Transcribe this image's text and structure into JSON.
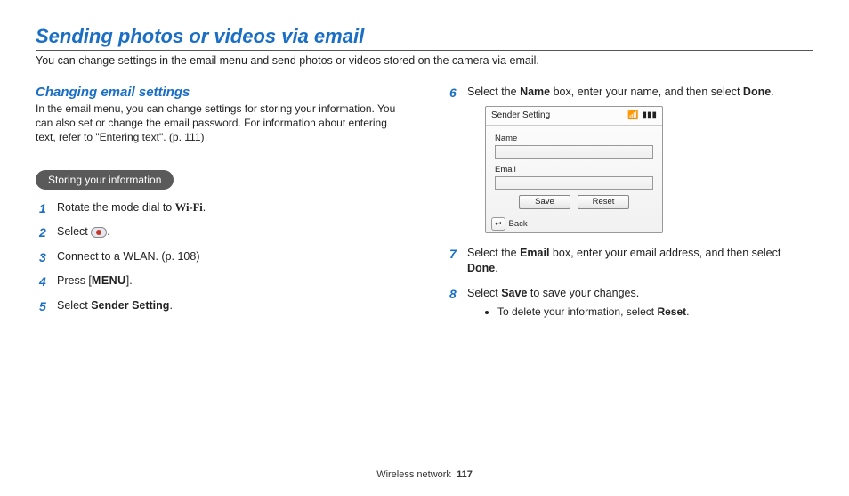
{
  "title": "Sending photos or videos via email",
  "intro": "You can change settings in the email menu and send photos or videos stored on the camera via email.",
  "left": {
    "heading": "Changing email settings",
    "para": "In the email menu, you can change settings for storing your information. You can also set or change the email password. For information about entering text, refer to \"Entering text\". (p. 111)",
    "pill": "Storing your information",
    "steps": {
      "s1_a": "Rotate the mode dial to ",
      "s1_wifi": "Wi-Fi",
      "s1_b": ".",
      "s2_a": "Select ",
      "s2_b": ".",
      "s3": "Connect to a WLAN. (p. 108)",
      "s4_a": "Press [",
      "s4_menu": "MENU",
      "s4_b": "].",
      "s5_a": "Select ",
      "s5_bold": "Sender Setting",
      "s5_b": "."
    }
  },
  "right": {
    "s6_a": "Select the ",
    "s6_bold1": "Name",
    "s6_b": " box, enter your name, and then select ",
    "s6_bold2": "Done",
    "s6_c": ".",
    "device": {
      "title": "Sender Setting",
      "name_label": "Name",
      "email_label": "Email",
      "save": "Save",
      "reset": "Reset",
      "back": "Back"
    },
    "s7_a": "Select the ",
    "s7_bold1": "Email",
    "s7_b": " box, enter your email address, and then select ",
    "s7_bold2": "Done",
    "s7_c": ".",
    "s8_a": "Select ",
    "s8_bold": "Save",
    "s8_b": " to save your changes.",
    "s8_bullet_a": "To delete your information, select ",
    "s8_bullet_bold": "Reset",
    "s8_bullet_b": "."
  },
  "footer": {
    "section": "Wireless network",
    "page": "117"
  }
}
